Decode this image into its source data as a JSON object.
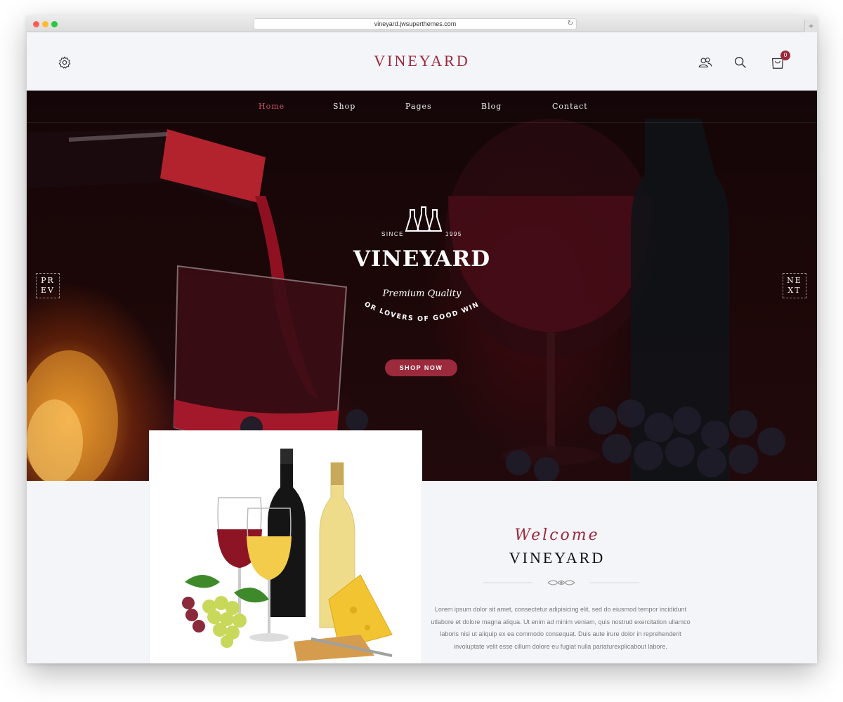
{
  "browser": {
    "url": "vineyard.jwsuperthemes.com"
  },
  "header": {
    "logo": "VINEYARD",
    "cart_count": "0"
  },
  "nav": {
    "items": [
      {
        "label": "Home",
        "active": true
      },
      {
        "label": "Shop",
        "active": false
      },
      {
        "label": "Pages",
        "active": false
      },
      {
        "label": "Blog",
        "active": false
      },
      {
        "label": "Contact",
        "active": false
      }
    ]
  },
  "hero": {
    "since": "SINCE",
    "year": "1995",
    "title": "VINEYARD",
    "premium": "Premium Quality",
    "tagline": "FOR LOVERS OF GOOD WINE",
    "prev": "PR EV",
    "next": "NE XT",
    "cta": "SHOP NOW"
  },
  "welcome": {
    "script": "Welcome",
    "title": "VINEYARD",
    "body": "Lorem ipsum dolor sit amet, consectetur adipisicing elit, sed do eiusmod tempor incididunt utlabore et dolore magna aliqua. Ut enim ad minim veniam, quis nostrud exercitation ullamco laboris nisi ut aliquip ex ea commodo consequat. Duis aute irure dolor in reprehenderit involuptate velit esse cillum dolore eu fugiat nulla pariaturexplicabout labore."
  },
  "icons": {
    "settings": "gear-icon",
    "account": "users-icon",
    "search": "search-icon",
    "cart": "shopping-bag-icon",
    "reload": "reload-icon"
  },
  "colors": {
    "brand": "#9b2a3c",
    "nav_active": "#c9546a",
    "page_bg": "#f4f5f9",
    "hero_bg": "#1c0708"
  }
}
